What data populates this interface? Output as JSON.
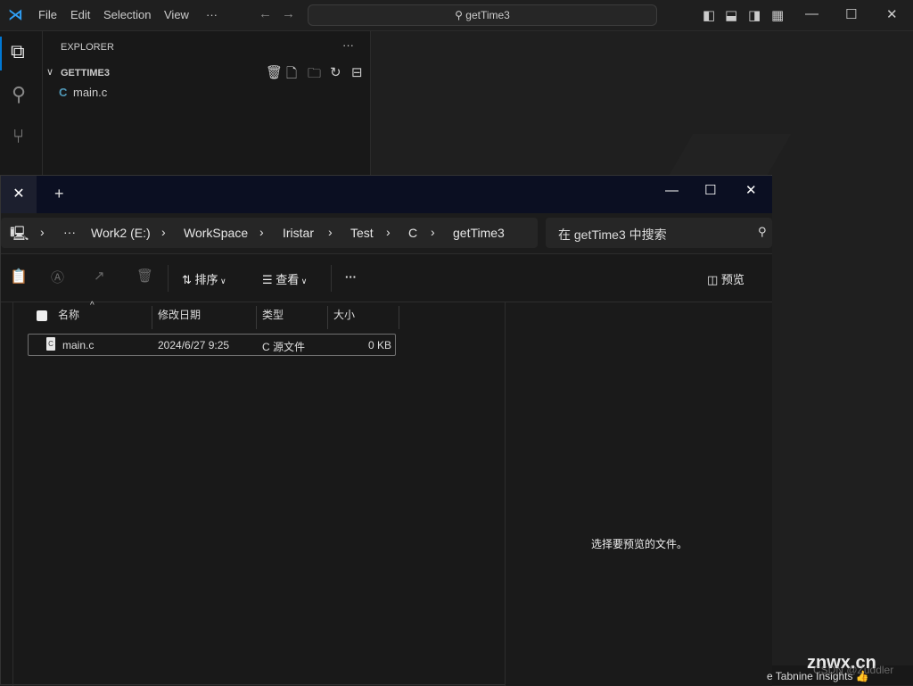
{
  "vscode": {
    "menu": [
      "File",
      "Edit",
      "Selection",
      "View",
      "···"
    ],
    "command_center": "getTime3",
    "explorer_title": "EXPLORER",
    "more": "···",
    "folder": "GETTIME3",
    "files": [
      {
        "name": "main.c",
        "icon": "C"
      }
    ],
    "status": "e Tabnine Insights 👍",
    "accent": "#0078d4"
  },
  "explorer_window": {
    "tab_close": "✕",
    "new_tab": "+",
    "breadcrumb": [
      "···",
      "Work2 (E:)",
      "WorkSpace",
      "Iristar",
      "Test",
      "C",
      "getTime3"
    ],
    "search_placeholder": "在 getTime3 中搜索",
    "toolbar": {
      "sort": "排序",
      "view": "查看",
      "more": "···",
      "preview": "预览"
    },
    "columns": [
      "名称",
      "修改日期",
      "类型",
      "大小"
    ],
    "rows": [
      {
        "name": "main.c",
        "date": "2024/6/27 9:25",
        "type": "C 源文件",
        "size": "0 KB"
      }
    ],
    "preview_message": "选择要预览的文件。"
  },
  "watermarks": [
    "znwx.cn",
    "CSDN @Zuddler"
  ]
}
